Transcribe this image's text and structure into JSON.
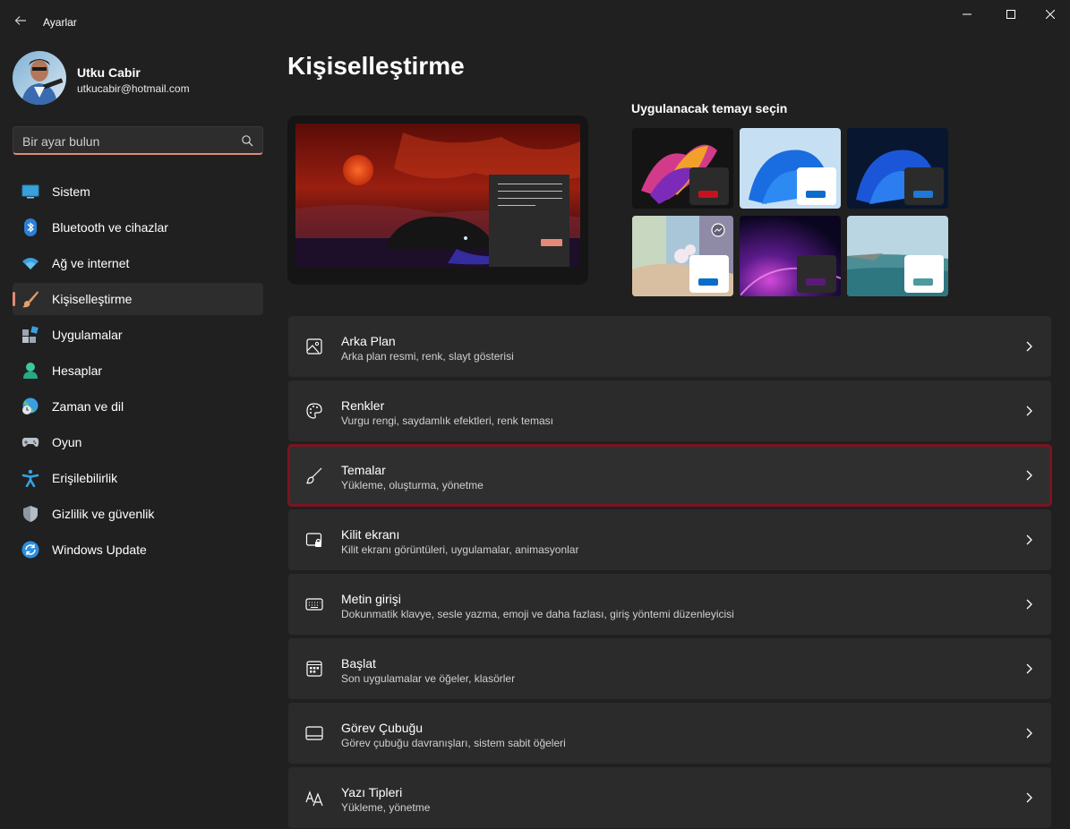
{
  "window": {
    "title": "Ayarlar"
  },
  "profile": {
    "name": "Utku Cabir",
    "email": "utkucabir@hotmail.com"
  },
  "search": {
    "placeholder": "Bir ayar bulun",
    "value": ""
  },
  "sidebar": {
    "items": [
      {
        "label": "Sistem",
        "icon": "system-icon"
      },
      {
        "label": "Bluetooth ve cihazlar",
        "icon": "bluetooth-icon"
      },
      {
        "label": "Ağ ve internet",
        "icon": "wifi-icon"
      },
      {
        "label": "Kişiselleştirme",
        "icon": "brush-icon",
        "active": true
      },
      {
        "label": "Uygulamalar",
        "icon": "apps-icon"
      },
      {
        "label": "Hesaplar",
        "icon": "account-icon"
      },
      {
        "label": "Zaman ve dil",
        "icon": "time-language-icon"
      },
      {
        "label": "Oyun",
        "icon": "gamepad-icon"
      },
      {
        "label": "Erişilebilirlik",
        "icon": "accessibility-icon"
      },
      {
        "label": "Gizlilik ve güvenlik",
        "icon": "shield-icon"
      },
      {
        "label": "Windows Update",
        "icon": "update-icon"
      }
    ]
  },
  "main": {
    "title": "Kişiselleştirme",
    "themes_heading": "Uygulanacak temayı seçin",
    "accent_color": "#e08a78",
    "settings": [
      {
        "title": "Arka Plan",
        "desc": "Arka plan resmi, renk, slayt gösterisi",
        "icon": "picture-icon"
      },
      {
        "title": "Renkler",
        "desc": "Vurgu rengi, saydamlık efektleri, renk teması",
        "icon": "palette-icon"
      },
      {
        "title": "Temalar",
        "desc": "Yükleme, oluşturma, yönetme",
        "icon": "brush-icon",
        "highlighted": true
      },
      {
        "title": "Kilit ekranı",
        "desc": "Kilit ekranı görüntüleri, uygulamalar, animasyonlar",
        "icon": "lock-screen-icon"
      },
      {
        "title": "Metin girişi",
        "desc": "Dokunmatik klavye, sesle yazma, emoji ve daha fazlası, giriş yöntemi düzenleyicisi",
        "icon": "keyboard-icon"
      },
      {
        "title": "Başlat",
        "desc": "Son uygulamalar ve öğeler, klasörler",
        "icon": "start-icon"
      },
      {
        "title": "Görev Çubuğu",
        "desc": "Görev çubuğu davranışları, sistem sabit öğeleri",
        "icon": "taskbar-icon"
      },
      {
        "title": "Yazı Tipleri",
        "desc": "Yükleme, yönetme",
        "icon": "fonts-icon"
      }
    ]
  }
}
